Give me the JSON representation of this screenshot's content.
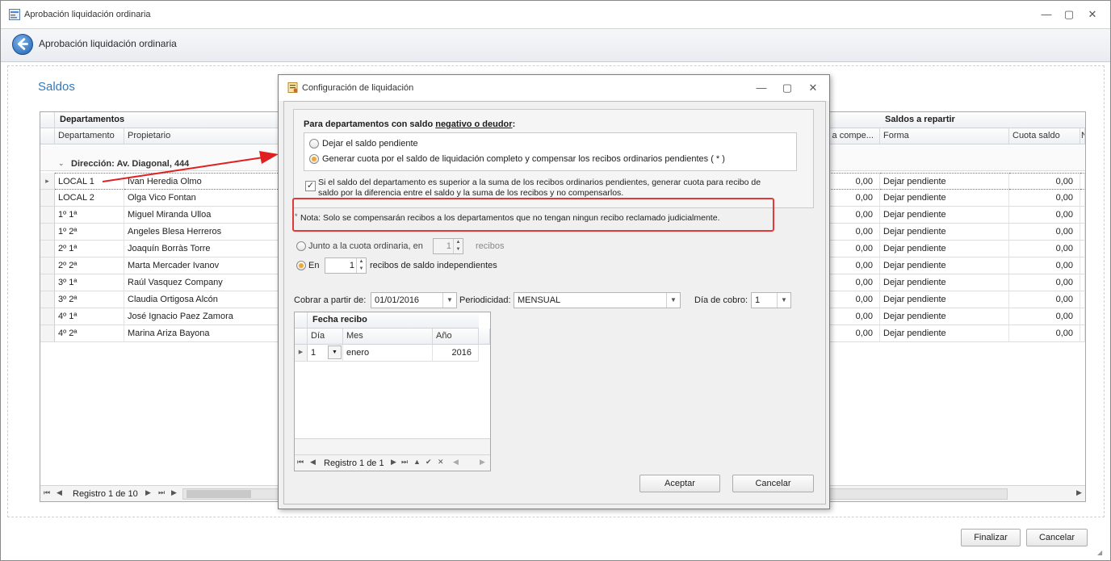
{
  "window": {
    "title": "Aprobación liquidación ordinaria",
    "min": "—",
    "max": "▢",
    "close": "✕"
  },
  "header": {
    "title": "Aprobación liquidación ordinaria"
  },
  "page": {
    "section_title": "Saldos"
  },
  "grid": {
    "band_left": "Departamentos",
    "band_right": "Saldos a repartir",
    "col_departamento": "Departamento",
    "col_propietario": "Propietario",
    "col_compensar": "s a compe...",
    "col_forma": "Forma",
    "col_cuota": "Cuota saldo",
    "col_extra": "N",
    "group_label": "Dirección: Av. Diagonal, 444",
    "rows": [
      {
        "dep": "LOCAL 1",
        "prop": "Ivan Heredia Olmo",
        "comp": "0,00",
        "forma": "Dejar pendiente",
        "cuota": "0,00"
      },
      {
        "dep": "LOCAL 2",
        "prop": "Olga Vico Fontan",
        "comp": "0,00",
        "forma": "Dejar pendiente",
        "cuota": "0,00"
      },
      {
        "dep": "1º 1ª",
        "prop": "Miguel Miranda Ulloa",
        "comp": "0,00",
        "forma": "Dejar pendiente",
        "cuota": "0,00"
      },
      {
        "dep": "1º 2ª",
        "prop": "Angeles Blesa Herreros",
        "comp": "0,00",
        "forma": "Dejar pendiente",
        "cuota": "0,00"
      },
      {
        "dep": "2º 1ª",
        "prop": "Joaquín Borràs Torre",
        "comp": "0,00",
        "forma": "Dejar pendiente",
        "cuota": "0,00"
      },
      {
        "dep": "2º 2ª",
        "prop": "Marta Mercader Ivanov",
        "comp": "0,00",
        "forma": "Dejar pendiente",
        "cuota": "0,00"
      },
      {
        "dep": "3º 1ª",
        "prop": "Raúl Vasquez Company",
        "comp": "0,00",
        "forma": "Dejar pendiente",
        "cuota": "0,00"
      },
      {
        "dep": "3º 2ª",
        "prop": "Claudia Ortigosa Alcón",
        "comp": "0,00",
        "forma": "Dejar pendiente",
        "cuota": "0,00"
      },
      {
        "dep": "4º 1ª",
        "prop": "José Ignacio Paez Zamora",
        "comp": "0,00",
        "forma": "Dejar pendiente",
        "cuota": "0,00"
      },
      {
        "dep": "4º 2ª",
        "prop": "Marina Ariza Bayona",
        "comp": "0,00",
        "forma": "Dejar pendiente",
        "cuota": "0,00"
      }
    ],
    "nav_label": "Registro 1 de 10"
  },
  "footer": {
    "finalizar": "Finalizar",
    "cancelar": "Cancelar"
  },
  "dialog": {
    "title": "Configuración de liquidación",
    "group_prefix": "Para departamentos con saldo ",
    "group_underlined": "negativo o deudor",
    "group_suffix": ":",
    "opt_dejar": "Dejar el saldo pendiente",
    "opt_generar": "Generar cuota por el saldo de liquidación completo y compensar los recibos ordinarios pendientes ( * )",
    "check_text_1": "Si el saldo del departamento es superior a la suma de los recibos ordinarios pendientes, generar cuota para recibo de",
    "check_text_2": "saldo por la diferencia entre el saldo y la suma de los recibos y no compensarlos.",
    "note": "Nota: Solo se compensarán recibos a los departamentos que no tengan ningun recibo reclamado judicialmente.",
    "note_star": "*",
    "opt_junto": "Junto a la cuota ordinaria, en",
    "junto_value": "1",
    "junto_suffix": "recibos",
    "opt_en": "En",
    "en_value": "1",
    "en_suffix": "recibos de saldo independientes",
    "cobrar_label": "Cobrar a partir de:",
    "cobrar_value": "01/01/2016",
    "periodicidad_label": "Periodicidad:",
    "periodicidad_value": "MENSUAL",
    "dia_label": "Día de cobro:",
    "dia_value": "1",
    "fecha_band": "Fecha recibo",
    "col_dia": "Día",
    "col_mes": "Mes",
    "col_anio": "Año",
    "row": {
      "dia": "1",
      "mes": "enero",
      "anio": "2016"
    },
    "nav_label": "Registro 1 de 1",
    "aceptar": "Aceptar",
    "cancelar": "Cancelar"
  },
  "colors": {
    "accent": "#2f7bbf",
    "highlight": "#e23a3a",
    "radio_on": "#f0a830"
  }
}
